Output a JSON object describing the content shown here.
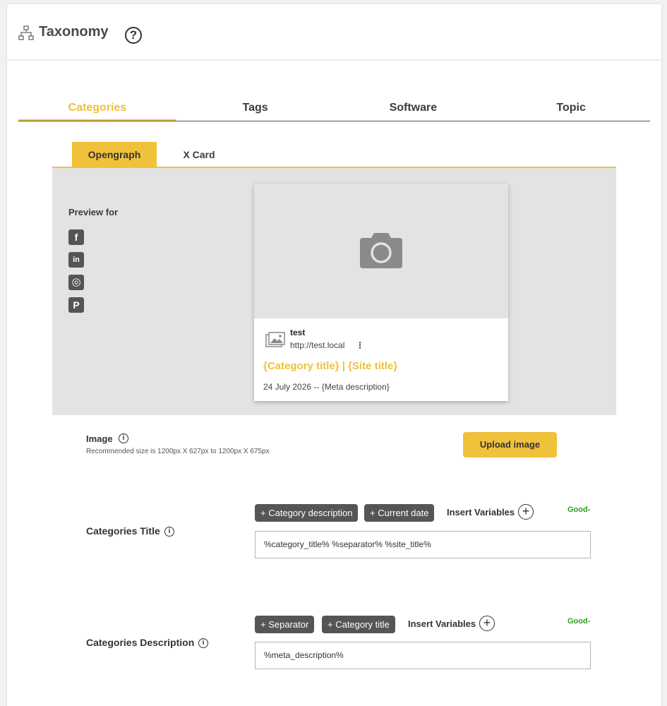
{
  "header": {
    "title": "Taxonomy",
    "help_symbol": "?"
  },
  "tabs": [
    {
      "label": "Categories",
      "active": true
    },
    {
      "label": "Tags",
      "active": false
    },
    {
      "label": "Software",
      "active": false
    },
    {
      "label": "Topic",
      "active": false
    }
  ],
  "subtabs": [
    {
      "label": "Opengraph",
      "active": true
    },
    {
      "label": "X Card",
      "active": false
    }
  ],
  "preview": {
    "label": "Preview for",
    "social": [
      {
        "name": "facebook-icon",
        "glyph": "f"
      },
      {
        "name": "linkedin-icon",
        "glyph": "in"
      },
      {
        "name": "instagram-icon",
        "glyph": "◎"
      },
      {
        "name": "pinterest-icon",
        "glyph": "P"
      }
    ],
    "card": {
      "site_name": "test",
      "site_url": "http://test.local",
      "kebab": "⋮",
      "title": "{Category title} | {Site title}",
      "description": "24 July 2026 -- {Meta description}"
    }
  },
  "image_section": {
    "label": "Image",
    "hint": "Recommended size is 1200px X 627px to 1200px X 675px",
    "upload_label": "Upload image"
  },
  "title_section": {
    "label": "Categories Title",
    "chips": [
      "+ Category description",
      "+ Current date"
    ],
    "insert_label": "Insert Variables",
    "status": "Good-",
    "value": "%category_title%  %separator%  %site_title%"
  },
  "description_section": {
    "label": "Categories Description",
    "chips": [
      "+ Separator",
      "+ Category title"
    ],
    "insert_label": "Insert Variables",
    "status": "Good-",
    "value": "%meta_description%"
  },
  "colors": {
    "accent": "#f0c13a",
    "chip": "#555555",
    "good": "#2e9e1f"
  },
  "info_symbol": "i",
  "plus_symbol": "+"
}
